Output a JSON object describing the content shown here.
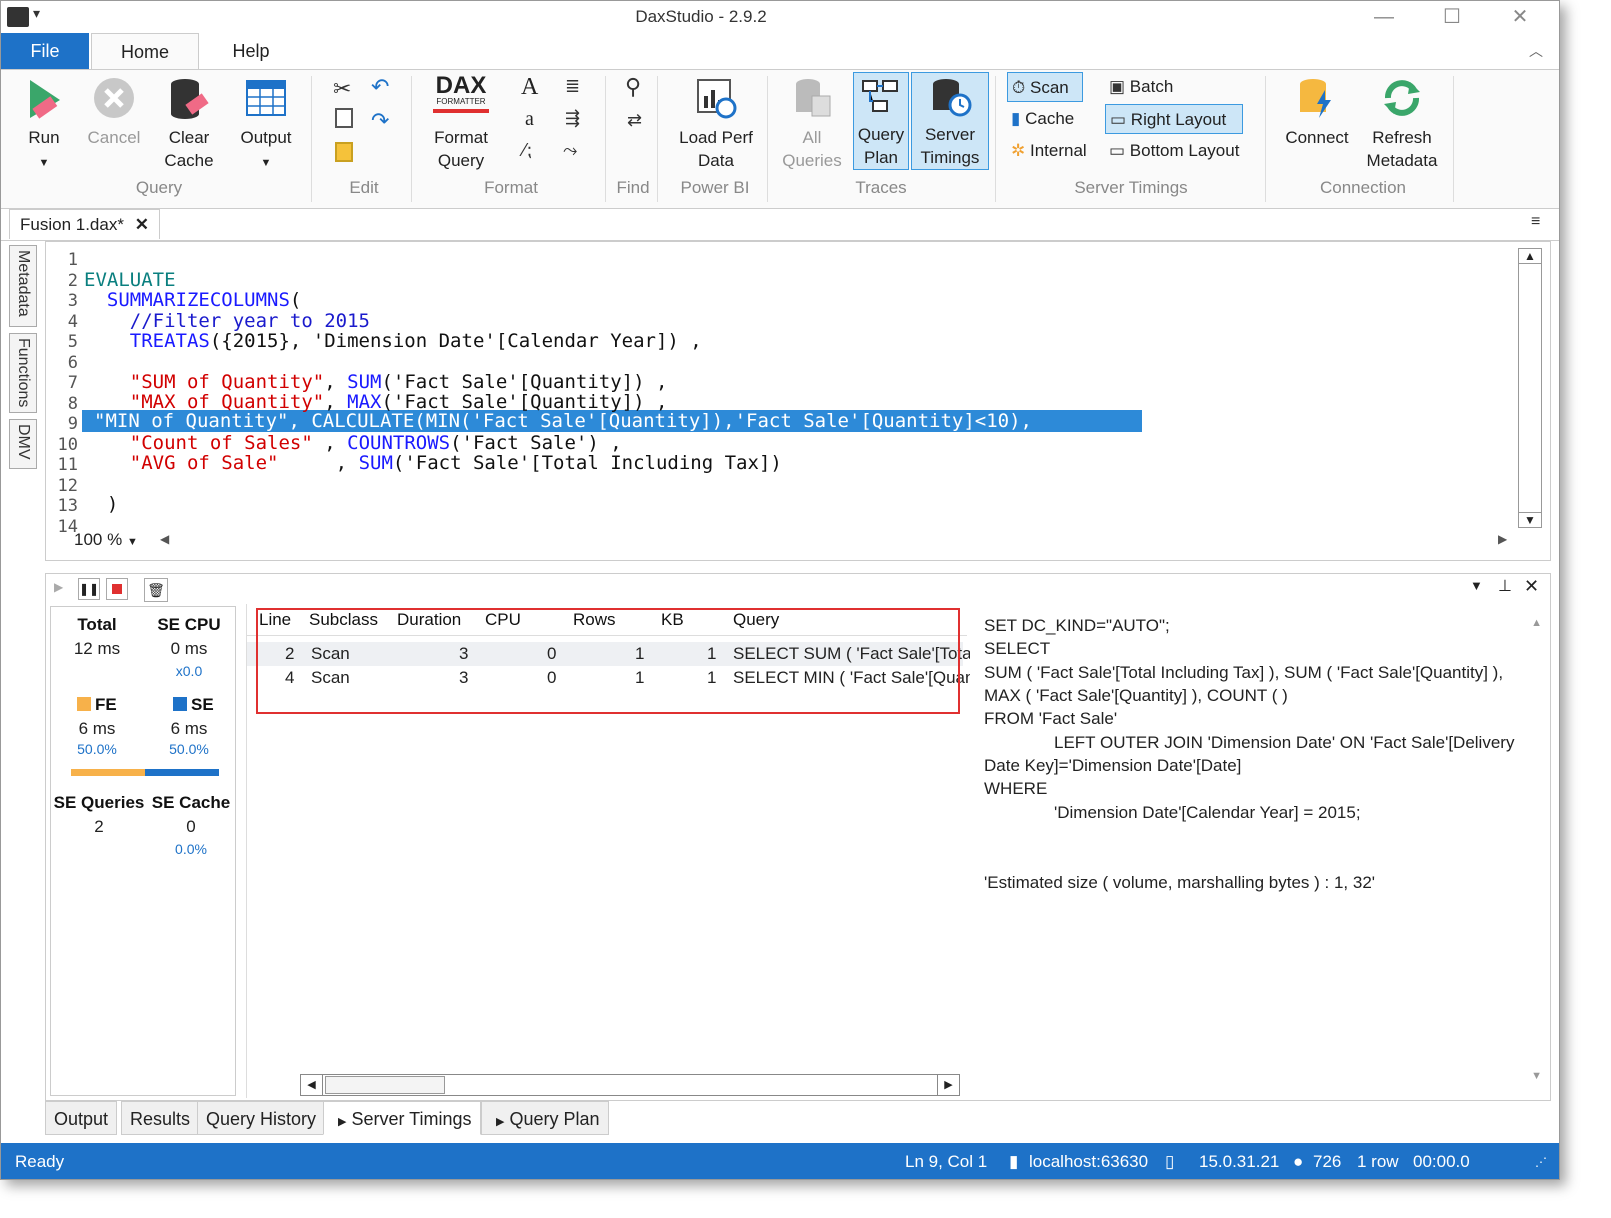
{
  "window": {
    "title": "DaxStudio - 2.9.2"
  },
  "ribbon": {
    "tabs": {
      "file": "File",
      "home": "Home",
      "help": "Help"
    },
    "query": {
      "run": "Run",
      "cancel": "Cancel",
      "clear_cache": "Clear Cache",
      "output": "Output",
      "group": "Query"
    },
    "edit": {
      "group": "Edit"
    },
    "format": {
      "dax_logo": "DAX",
      "dax_sub": "FORMATTER",
      "format_query": "Format Query",
      "font_big": "A",
      "font_small": "a",
      "group": "Format"
    },
    "find": {
      "group": "Find"
    },
    "powerbi": {
      "load_perf_data": "Load Perf Data",
      "group": "Power BI"
    },
    "traces": {
      "all_queries": "All Queries",
      "query_plan": "Query Plan",
      "server_timings": "Server Timings",
      "group": "Traces"
    },
    "server_timings": {
      "scan": "Scan",
      "cache": "Cache",
      "internal": "Internal",
      "batch": "Batch",
      "right_layout": "Right Layout",
      "bottom_layout": "Bottom Layout",
      "group": "Server Timings"
    },
    "connection": {
      "connect": "Connect",
      "refresh_metadata": "Refresh Metadata",
      "group": "Connection"
    }
  },
  "document": {
    "tab": "Fusion 1.dax*",
    "side_tabs": [
      "Metadata",
      "Functions",
      "DMV"
    ]
  },
  "editor": {
    "line_numbers": [
      "1",
      "2",
      "3",
      "4",
      "5",
      "6",
      "7",
      "8",
      "9",
      "10",
      "11",
      "12",
      "13",
      "14"
    ],
    "lines": {
      "l2": "EVALUATE",
      "l3_fn": "SUMMARIZECOLUMNS",
      "l3_rest": "(",
      "l4": "//Filter year to 2015",
      "l5_fn": "TREATAS",
      "l5_rest": "({2015}, 'Dimension Date'[Calendar Year]) ,",
      "l7_str": "\"SUM of Quantity\"",
      "l7_sep": ", ",
      "l7_fn": "SUM",
      "l7_rest": "('Fact Sale'[Quantity]) ,",
      "l8_str": "\"MAX of Quantity\"",
      "l8_sep": ", ",
      "l8_fn": "MAX",
      "l8_rest": "('Fact Sale'[Quantity]) ,",
      "l9": "\"MIN of Quantity\", CALCULATE(MIN('Fact Sale'[Quantity]),'Fact Sale'[Quantity]<10),",
      "l10_str": "\"Count of Sales\"",
      "l10_sep": " , ",
      "l10_fn": "COUNTROWS",
      "l10_rest": "('Fact Sale') ,",
      "l11_str": "\"AVG of Sale\"",
      "l11_sep": "     , ",
      "l11_fn": "SUM",
      "l11_rest": "('Fact Sale'[Total Including Tax])",
      "l13": ")"
    },
    "zoom": "100 %"
  },
  "summary": {
    "total_label": "Total",
    "total_value": "12 ms",
    "se_cpu_label": "SE CPU",
    "se_cpu_value": "0 ms",
    "se_cpu_ratio": "x0.0",
    "fe_label": "FE",
    "fe_value": "6 ms",
    "fe_pct": "50.0%",
    "se_label": "SE",
    "se_value": "6 ms",
    "se_pct": "50.0%",
    "fe_fraction": 0.5,
    "se_queries_label": "SE Queries",
    "se_queries_value": "2",
    "se_cache_label": "SE Cache",
    "se_cache_value": "0",
    "se_cache_pct": "0.0%",
    "fe_color": "#f7b14a",
    "se_color": "#1e72c8"
  },
  "timings_grid": {
    "columns": [
      "Line",
      "Subclass",
      "Duration",
      "CPU",
      "Rows",
      "KB",
      "Query"
    ],
    "rows": [
      {
        "line": "2",
        "subclass": "Scan",
        "duration": "3",
        "cpu": "0",
        "rows": "1",
        "kb": "1",
        "query": "SELECT SUM ( 'Fact Sale'[Tota"
      },
      {
        "line": "4",
        "subclass": "Scan",
        "duration": "3",
        "cpu": "0",
        "rows": "1",
        "kb": "1",
        "query": "SELECT MIN ( 'Fact Sale'[Quan"
      }
    ]
  },
  "query_text": {
    "l1": "SET DC_KIND=\"AUTO\";",
    "l2": "SELECT",
    "l3": "SUM ( 'Fact Sale'[Total Including Tax] ), SUM ( 'Fact Sale'[Quantity] ),",
    "l4": "MAX ( 'Fact Sale'[Quantity] ), COUNT (  )",
    "l5": "FROM 'Fact Sale'",
    "l6": "LEFT OUTER JOIN 'Dimension Date' ON 'Fact Sale'[Delivery",
    "l7": "Date Key]='Dimension Date'[Date]",
    "l8": "WHERE",
    "l9": "'Dimension Date'[Calendar Year] = 2015;",
    "l10": "'Estimated size ( volume, marshalling bytes ) : 1, 32'"
  },
  "bottom_tabs": [
    "Output",
    "Results",
    "Query History",
    "Server Timings",
    "Query Plan"
  ],
  "status": {
    "state": "Ready",
    "position": "Ln 9, Col 1",
    "server": "localhost:63630",
    "version": "15.0.31.21",
    "spid": "726",
    "rows": "1 row",
    "elapsed": "00:00.0"
  },
  "colors": {
    "accent": "#1e72c8",
    "selection": "#2d8ad8",
    "highlight_box": "#e03030"
  }
}
